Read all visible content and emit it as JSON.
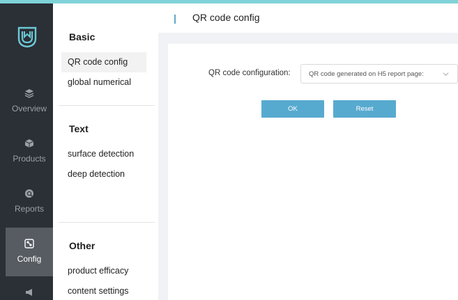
{
  "rail": {
    "items": [
      {
        "icon": "overview-icon",
        "label": "Overview"
      },
      {
        "icon": "products-icon",
        "label": "Products"
      },
      {
        "icon": "reports-icon",
        "label": "Reports"
      },
      {
        "icon": "config-icon",
        "label": "Config",
        "active": true
      },
      {
        "icon": "megaphone-icon",
        "label": ""
      }
    ]
  },
  "menu": {
    "sections": [
      {
        "title": "Basic",
        "items": [
          "QR code config",
          "global numerical"
        ]
      },
      {
        "title": "Text",
        "items": [
          "surface detection",
          "deep detection"
        ]
      },
      {
        "title": "Other",
        "items": [
          "product efficacy",
          "content settings"
        ]
      }
    ],
    "active_item": "QR code config"
  },
  "header": {
    "title": "QR code config"
  },
  "form": {
    "label": "QR code configuration:",
    "select_value": "QR code generated on H5 report page:",
    "ok_label": "OK",
    "reset_label": "Reset"
  },
  "colors": {
    "rail_bg": "#2b2f36",
    "rail_active": "#575b62",
    "accent": "#57aacf",
    "top_strip": "#7fd3d8"
  }
}
